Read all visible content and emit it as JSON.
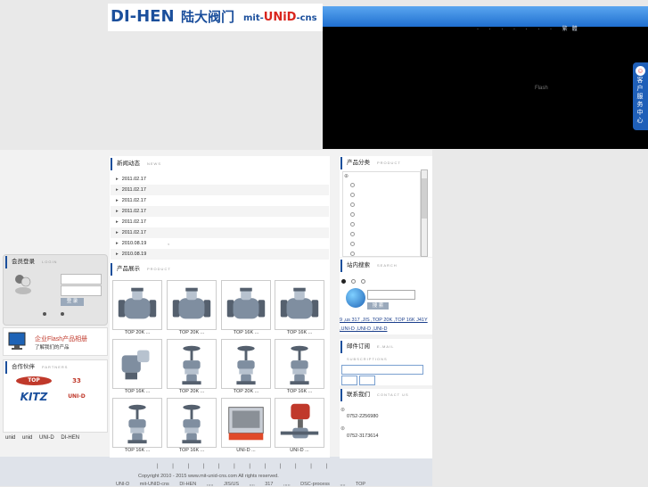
{
  "header": {
    "logo_main": "DI-HEN",
    "logo_cn": "陆大阀门",
    "logo_unid_prefix": "mit-",
    "logo_unid": "UNiD",
    "logo_unid_suffix": "-cns",
    "nav_links": "· · · · · · · 繁體",
    "flash_label": "Flash"
  },
  "service": {
    "label": "客户服务中心"
  },
  "news": {
    "title": "新闻动态",
    "subtitle": "NEWS",
    "items": [
      {
        "date": "2011.02.17",
        "text": ""
      },
      {
        "date": "2011.02.17",
        "text": ""
      },
      {
        "date": "2011.02.17",
        "text": ""
      },
      {
        "date": "2011.02.17",
        "text": ""
      },
      {
        "date": "2011.02.17",
        "text": ""
      },
      {
        "date": "2011.02.17",
        "text": ""
      },
      {
        "date": "2010.08.19",
        "text": ","
      },
      {
        "date": "2010.08.19",
        "text": ""
      }
    ]
  },
  "products": {
    "title": "产品展示",
    "subtitle": "PRODUCT",
    "items": [
      {
        "caption": "TOP 20K ...",
        "kind": "check"
      },
      {
        "caption": "TOP 20K ...",
        "kind": "check2"
      },
      {
        "caption": "TOP 16K ...",
        "kind": "check3"
      },
      {
        "caption": "TOP 16K ...",
        "kind": "check"
      },
      {
        "caption": "TOP 16K ...",
        "kind": "elbow"
      },
      {
        "caption": "TOP 20K ...",
        "kind": "globe"
      },
      {
        "caption": "TOP 20K ...",
        "kind": "globe"
      },
      {
        "caption": "TOP 16K ...",
        "kind": "globe"
      },
      {
        "caption": "TOP 16K ...",
        "kind": "globe"
      },
      {
        "caption": "TOP 16K ...",
        "kind": "globe"
      },
      {
        "caption": "UNI-D ...",
        "kind": "box"
      },
      {
        "caption": "UNI-D ...",
        "kind": "actuator"
      }
    ]
  },
  "login": {
    "title": "会员登录",
    "subtitle": "LOGIN",
    "button": "登 录"
  },
  "promo": {
    "line1": "企业Flash产品相册",
    "line2": "了解我们的产品"
  },
  "partners": {
    "title": "合作伙伴",
    "subtitle": "PARTNERS",
    "logos": [
      "TOP",
      "33",
      "KITZ",
      "UNI-D"
    ]
  },
  "bottom_links": [
    "unid",
    "unid",
    "UNI-D",
    "DI-HEN"
  ],
  "categories": {
    "title": "产品分类",
    "subtitle": "PRODUCT"
  },
  "search": {
    "title": "站内搜索",
    "subtitle": "SEARCH",
    "button": "搜 索",
    "hot_words": "9 ,us 317 ,JIS ,TOP 20K ,TOP 16K J41Y ,UNI-D ,UNI-D ,UNI-D"
  },
  "mail": {
    "title": "邮件订阅",
    "subtitle": "E-MAIL SUBSCRIPTIONS"
  },
  "contact": {
    "title": "联系我们",
    "subtitle": "CONTACT US",
    "phone1": "0752-2256980",
    "phone2": "0752-3173614"
  },
  "footer": {
    "separators": "| | | | | | | | | | | |",
    "copyright": "Copyright 2010 - 2015 www.mit-unid-cns.com All rights reserved.",
    "links": "UNI-D mit-UNID-cns DI-HEN ,,,,, JIS/US ,,,, 317 ,,,,, DSC-process ,,,, TOP"
  }
}
